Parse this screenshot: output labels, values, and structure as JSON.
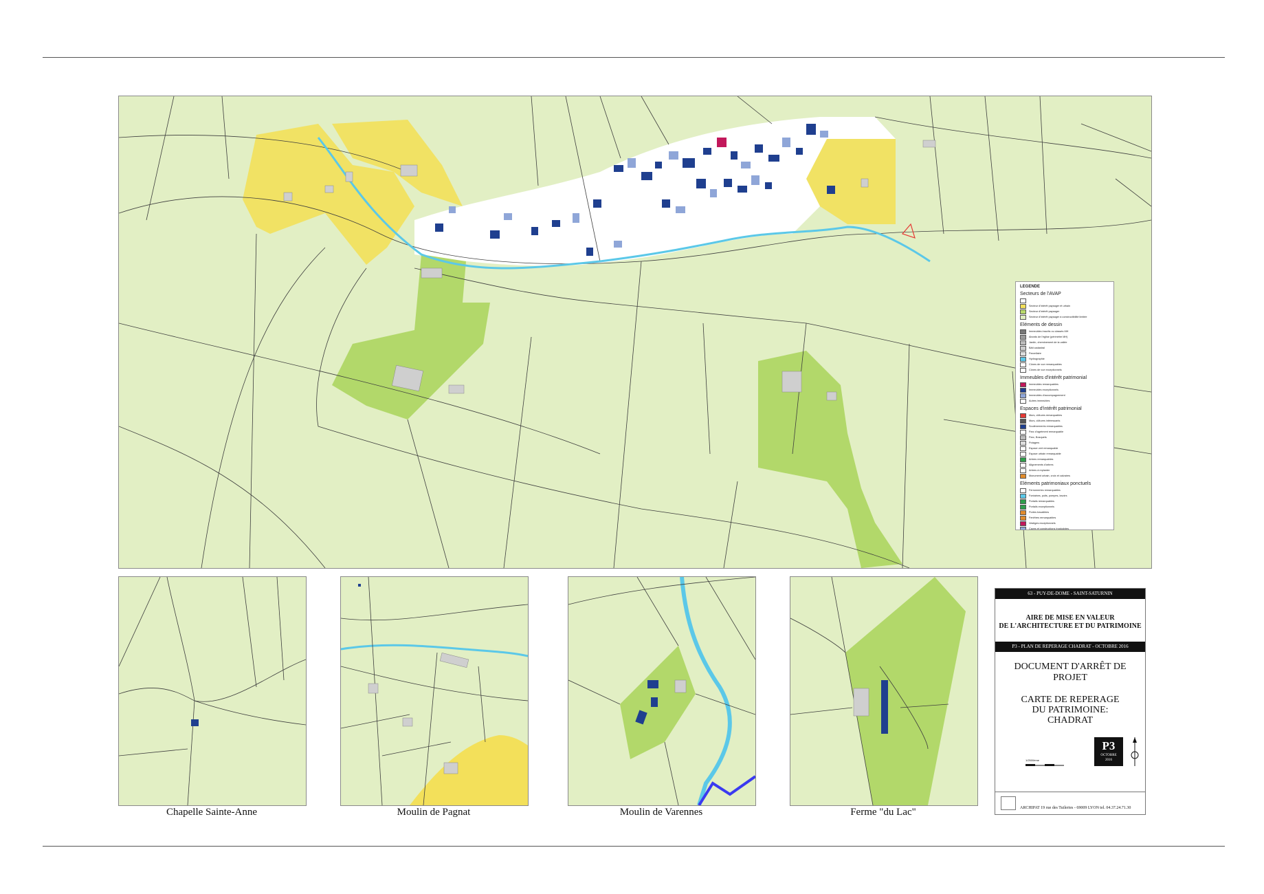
{
  "page": {
    "captions": [
      "Chapelle Sainte-Anne",
      "Moulin de Pagnat",
      "Moulin de Varennes",
      "Ferme \"du Lac\""
    ]
  },
  "legend": {
    "title": "LEGENDE",
    "sections": [
      {
        "heading": "Secteurs de l'AVAP",
        "rows": [
          {
            "color": "#ffffff",
            "text": ""
          },
          {
            "color": "#f3e05a",
            "text": "Secteur d'intérêt paysager et urbain"
          },
          {
            "color": "#b7d96a",
            "text": "Secteur d'intérêt paysager"
          },
          {
            "color": "#e0eec0",
            "text": "Secteur d'intérêt paysager à constructibilité limitée"
          }
        ]
      },
      {
        "heading": "Eléments de dessin",
        "rows": [
          {
            "color": "#777777",
            "text": "Immeubles inscrits ou classés MH"
          },
          {
            "color": "#999999",
            "text": "Abords de l'église (périmètre MH)"
          },
          {
            "color": "#bbbbbb",
            "text": "Jardin, cheminement de la vallée"
          },
          {
            "color": "#cccccc",
            "text": "Bâti cadastral"
          },
          {
            "color": "#dddddd",
            "text": "Parcellaire"
          },
          {
            "color": "#5bc8e8",
            "text": "Hydrographie"
          },
          {
            "color": "#ffffff",
            "text": "Cônes de vue remarquables"
          },
          {
            "color": "#ffffff",
            "text": "Cônes de vue exceptionnels"
          }
        ]
      },
      {
        "heading": "Immeubles d'intérêt patrimonial",
        "rows": [
          {
            "color": "#c2185b",
            "text": "Immeubles remarquables"
          },
          {
            "color": "#1f3f8f",
            "text": "Immeubles exceptionnels"
          },
          {
            "color": "#8fa6d8",
            "text": "Immeubles d'accompagnement"
          },
          {
            "color": "#ffffff",
            "text": "Autres immeubles"
          }
        ]
      },
      {
        "heading": "Espaces d'intérêt patrimonial",
        "rows": [
          {
            "color": "#e53935",
            "text": "Murs, clôtures remarquables"
          },
          {
            "color": "#555555",
            "text": "Murs, clôtures intéressants"
          },
          {
            "color": "#1f3f8f",
            "text": "Soutènements remarquables"
          },
          {
            "color": "#ffffff",
            "text": "Parc d'agrément remarquable"
          },
          {
            "color": "#bbbbbb",
            "text": "Parc, Bosquets"
          },
          {
            "color": "#dddddd",
            "text": "Potagers"
          },
          {
            "color": "#ffffff",
            "text": "Espace vert remarquable"
          },
          {
            "color": "#ffffff",
            "text": "Espace urbain remarquable"
          },
          {
            "color": "#2e9e4b",
            "text": "Arbres remarquables"
          },
          {
            "color": "#ffffff",
            "text": "Alignements d'arbres"
          },
          {
            "color": "#ffffff",
            "text": "Arbres à replanter"
          },
          {
            "color": "#e08b2c",
            "text": "Monument urbain, croix et calvaires"
          }
        ]
      },
      {
        "heading": "Eléments patrimoniaux ponctuels",
        "rows": [
          {
            "color": "#ffffff",
            "text": "Ferronneries remarquables"
          },
          {
            "color": "#5bc8e8",
            "text": "Fontaines, puits, pompes, lavoirs"
          },
          {
            "color": "#2e9e4b",
            "text": "Portails remarquables"
          },
          {
            "color": "#2e9e4b",
            "text": "Portails exceptionnels"
          },
          {
            "color": "#e08b2c",
            "text": "Portes travaillées"
          },
          {
            "color": "#e08b2c",
            "text": "Fenêtres remarquables"
          },
          {
            "color": "#c2185b",
            "text": "Vestiges exceptionnels"
          },
          {
            "color": "#8fa6d8",
            "text": "Caves et constructions troglodytes"
          }
        ]
      }
    ]
  },
  "title_block": {
    "band_top": "63 - PUY-DE-DOME - SAINT-SATURNIN",
    "heading_line1": "AIRE DE MISE EN VALEUR",
    "heading_line2": "DE L'ARCHITECTURE ET DU PATRIMOINE",
    "band_mid": "P3 - PLAN DE REPERAGE CHADRAT - OCTOBRE 2016",
    "doc": "DOCUMENT D'ARRÊT DE PROJET",
    "carte_line1": "CARTE DE REPERAGE",
    "carte_line2": "DU PATRIMOINE:",
    "carte_line3": "CHADRAT",
    "plate": "P3",
    "plate_month": "OCTOBRE",
    "plate_year": "2016",
    "scale_text": "1/2500ème",
    "footer": "ARCHIPAT 19 rue des Tuileries - 69009 LYON tel. 04.37.24.71.30"
  },
  "colors": {
    "parcel": "#e2efc4",
    "yellow": "#f3e05a",
    "green": "#b2d86a",
    "blue_dark": "#1f3f8f",
    "blue_light": "#8fa6d8",
    "river": "#5bc8e8",
    "building_grey": "#cfcfcf"
  }
}
